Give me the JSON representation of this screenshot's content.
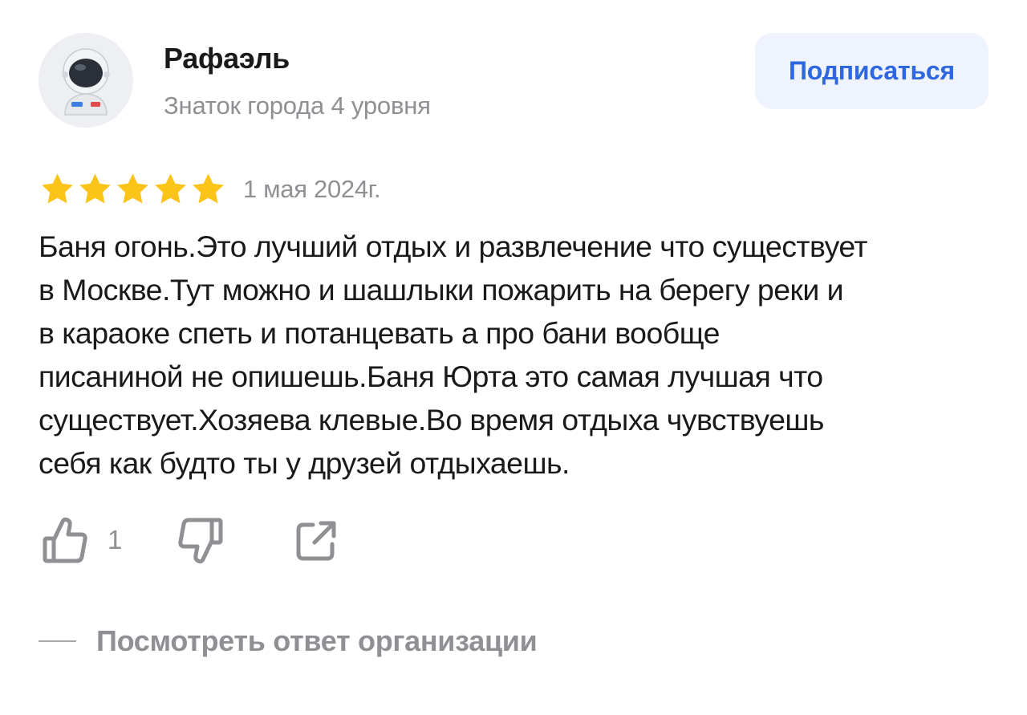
{
  "author": {
    "name": "Рафаэль",
    "level": "Знаток города 4 уровня",
    "avatar_icon": "astronaut-icon"
  },
  "subscribe": {
    "label": "Подписаться"
  },
  "rating": {
    "stars": 5,
    "max_stars": 5,
    "star_color": "#fcc419"
  },
  "date": "1 мая 2024г.",
  "review_text": "Баня огонь.Это лучший отдых и развлечение что существует\nв Москве.Тут можно и шашлыки пожарить на берегу реки и\nв караоке спеть и потанцевать а про бани вообще\nписаниной не опишешь.Баня Юрта это самая лучшая что\nсуществует.Хозяева клевые.Во время отдыха чувствуешь\nсебя как будто ты у друзей отдыхаешь.",
  "actions": {
    "like_icon": "thumbs-up-icon",
    "like_count": "1",
    "dislike_icon": "thumbs-down-icon",
    "share_icon": "share-icon"
  },
  "org_answer": {
    "label": "Посмотреть ответ организации"
  },
  "colors": {
    "accent": "#2f67e0",
    "button_bg": "#eef3fd",
    "muted_text": "#8f8f94",
    "main_text": "#1a1a1a"
  }
}
